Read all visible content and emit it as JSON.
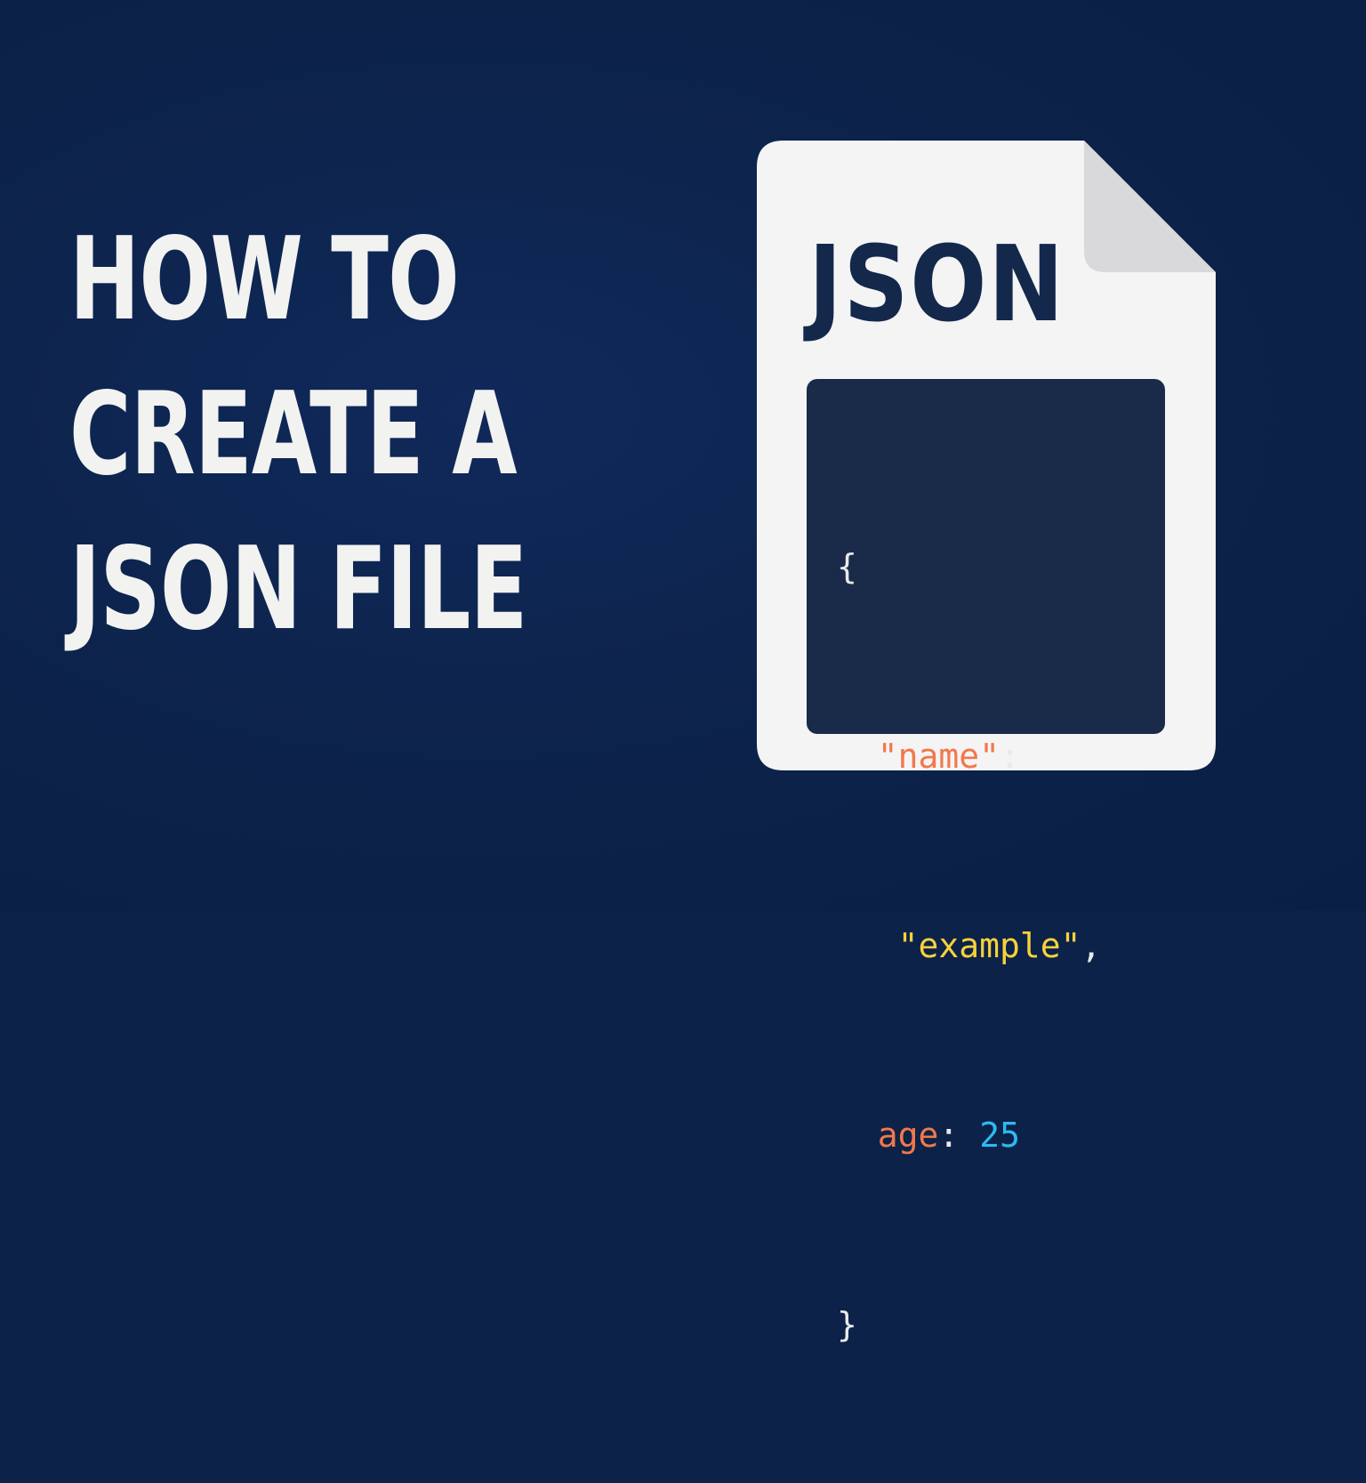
{
  "headline": {
    "line1": "HOW TO",
    "line2": "CREATE A",
    "line3": "JSON FILE"
  },
  "file_icon": {
    "label": "JSON",
    "code": {
      "open_brace": "{",
      "name_key": "\"name\"",
      "name_colon": ":",
      "name_value": "\"example\"",
      "name_comma": ",",
      "age_key": "age",
      "age_colon": ":",
      "age_value": "25",
      "close_brace": "}"
    }
  },
  "colors": {
    "background": "#0c2249",
    "headline_text": "#f2f2f0",
    "sheet": "#f4f4f4",
    "sheet_fold": "#d9d9dc",
    "label_text": "#14284c",
    "code_panel": "#1a2b4a",
    "code_key": "#f2784a",
    "code_string": "#f5d23a",
    "code_number": "#2fb9f2"
  }
}
